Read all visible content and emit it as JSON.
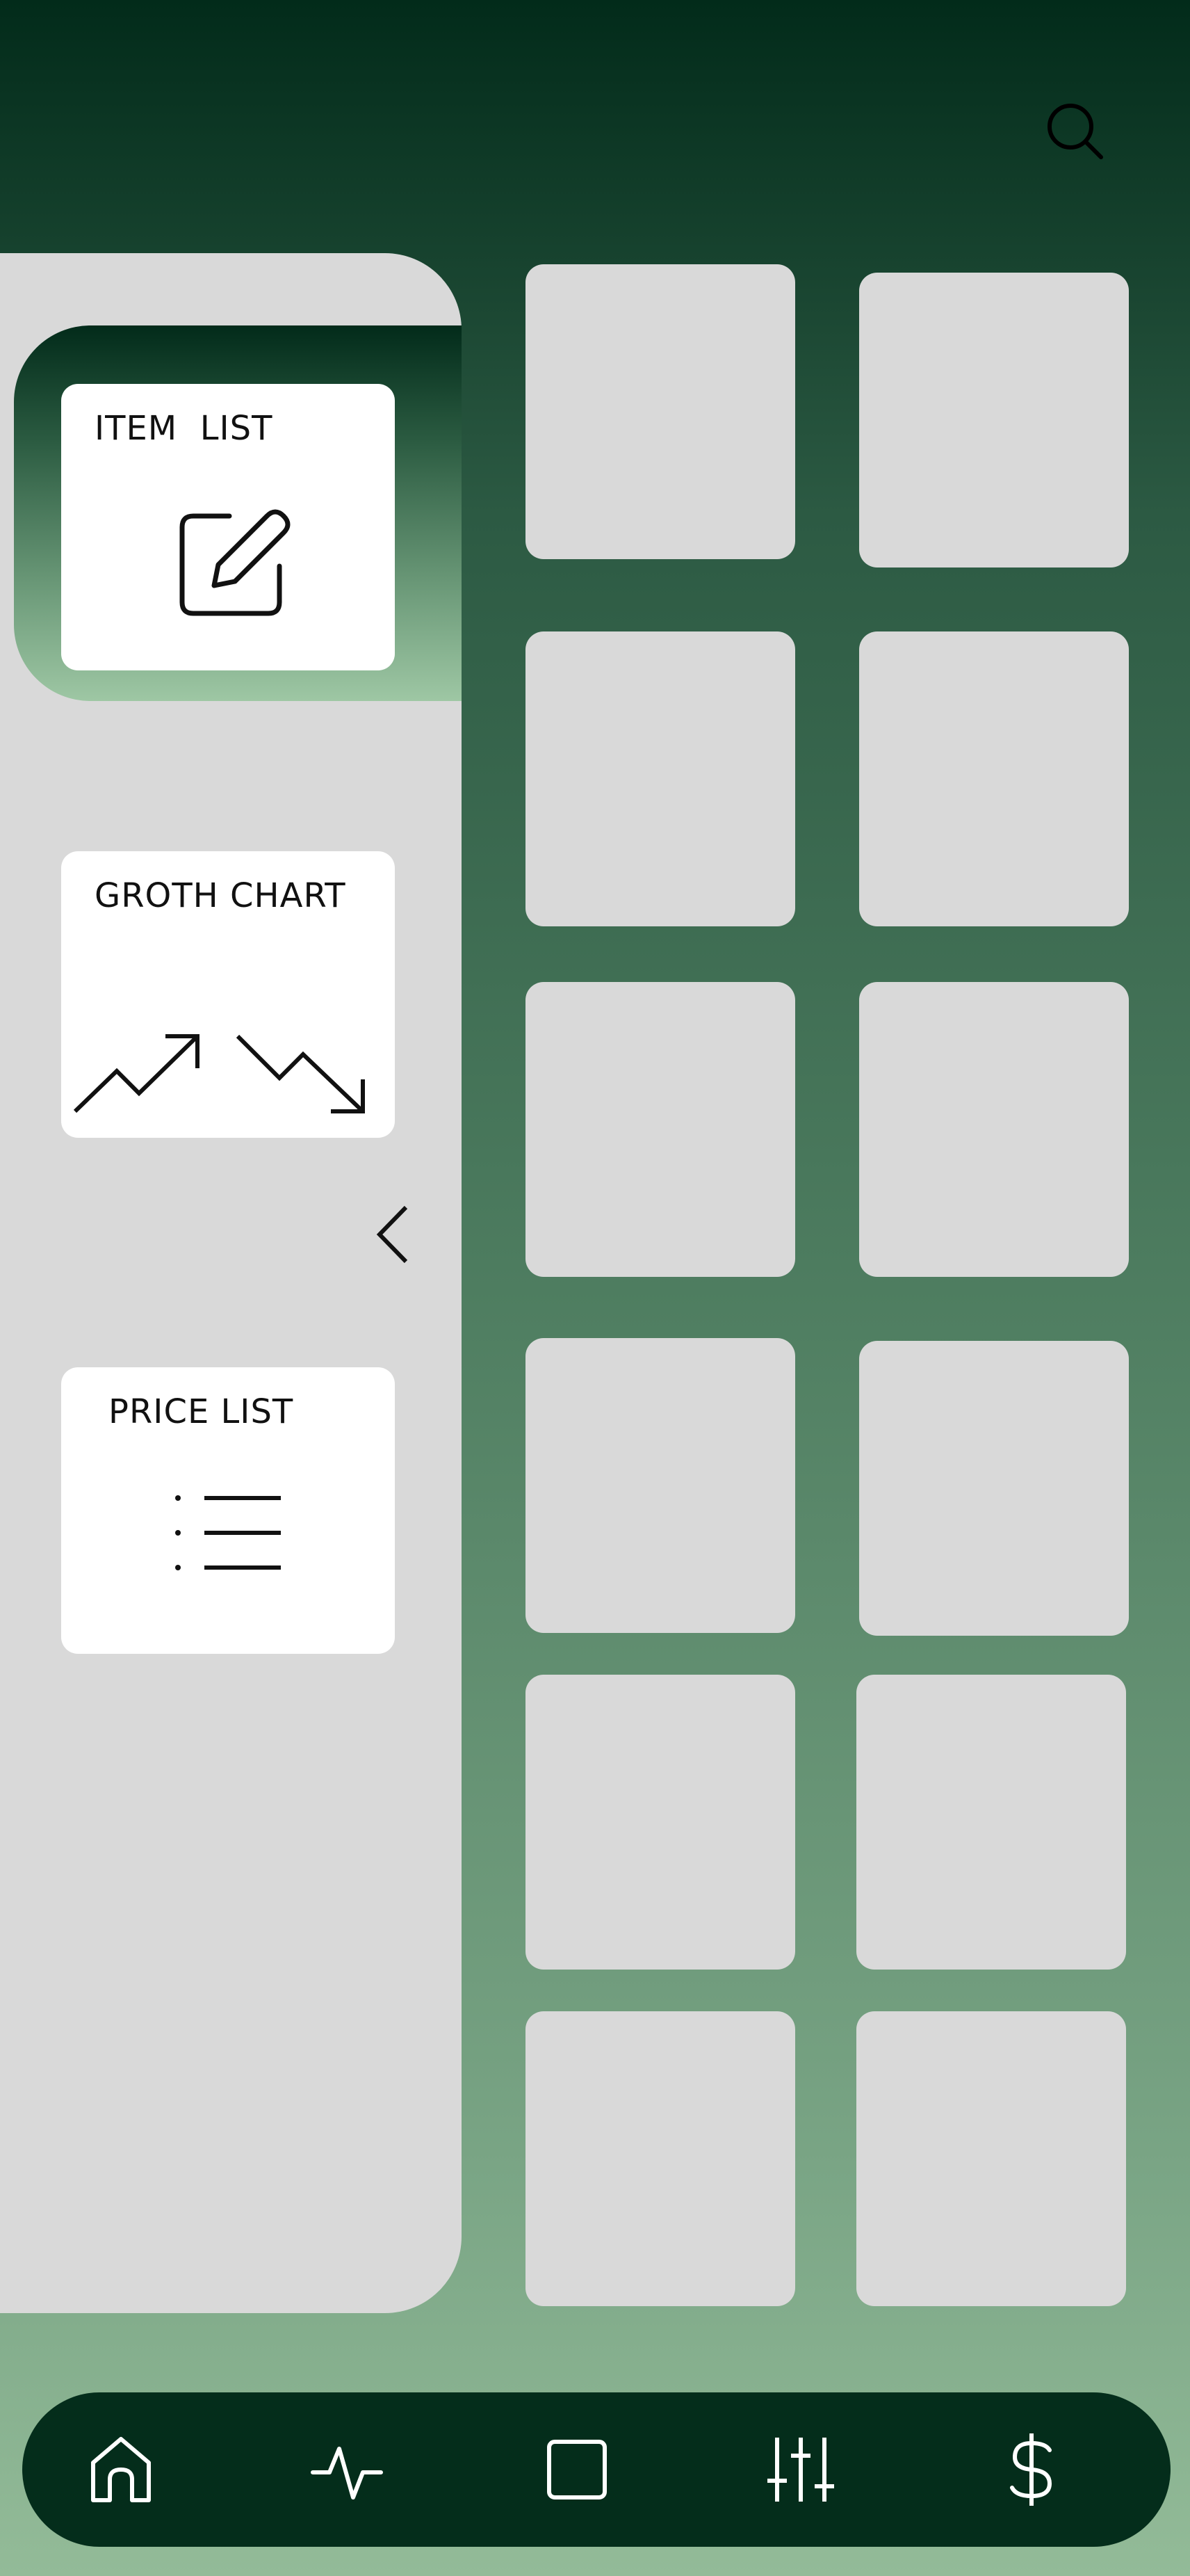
{
  "header": {
    "search_icon": "search-icon"
  },
  "side_panel": {
    "cards": [
      {
        "title": "ITEM  LIST",
        "icon": "edit-icon",
        "active": true
      },
      {
        "title": "GROTH CHART",
        "icon": "trend-icon",
        "active": false
      },
      {
        "title": "PRICE LIST",
        "icon": "list-icon",
        "active": false
      }
    ],
    "collapse_icon": "chevron-left-icon"
  },
  "grid": {
    "rows": 6,
    "columns": 2
  },
  "bottom_nav": {
    "items": [
      {
        "icon": "home-icon"
      },
      {
        "icon": "activity-icon"
      },
      {
        "icon": "square-icon"
      },
      {
        "icon": "sliders-icon"
      },
      {
        "icon": "dollar-icon"
      }
    ]
  },
  "colors": {
    "dark_green": "#022b1a",
    "light_green": "#93bb98",
    "panel_gray": "#d9d9d9",
    "card_white": "#ffffff"
  }
}
